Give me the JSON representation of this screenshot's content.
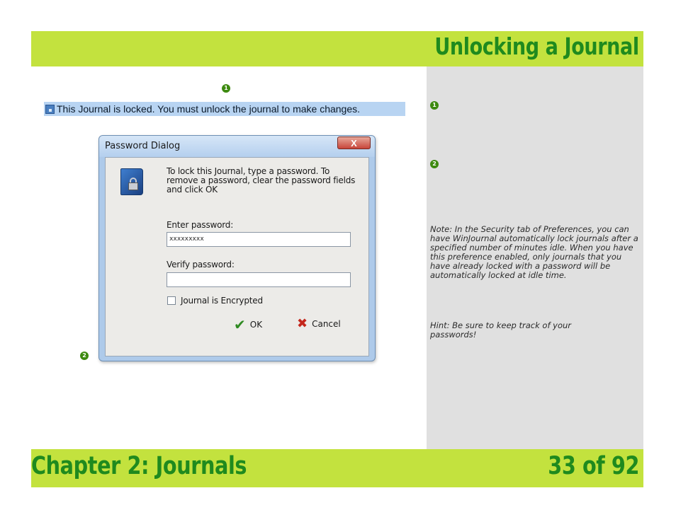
{
  "header": {
    "title": "Unlocking a Journal"
  },
  "footer": {
    "chapter": "Chapter 2: Journals",
    "page": "33 of 92"
  },
  "markers": {
    "one": "1",
    "two": "2"
  },
  "banner": {
    "text": "This Journal is locked. You must unlock the journal to make changes."
  },
  "dialog": {
    "title": "Password Dialog",
    "close_label": "X",
    "intro_line1": "To lock this Journal, type a password.  To",
    "intro_line2": "remove a password, clear the password fields",
    "intro_line3": "and click OK",
    "enter_label": "Enter password:",
    "enter_value": "xxxxxxxxx",
    "verify_label": "Verify password:",
    "verify_value": "",
    "encrypted_label": "Journal is Encrypted",
    "ok_label": "OK",
    "cancel_label": "Cancel"
  },
  "notes": {
    "note": "Note:  In the Security tab of Preferences, you can have WinJournal automatically lock journals after a specified number of minutes idle.  When you have this preference enabled, only journals that you have already locked with a password will be automatically locked at idle time.",
    "hint": "Hint: Be sure to keep track of your passwords!"
  },
  "colors": {
    "bar": "#c3e23e",
    "heading": "#1f8a1e",
    "panel": "#e0e0e0",
    "marker": "#3d8a10"
  }
}
